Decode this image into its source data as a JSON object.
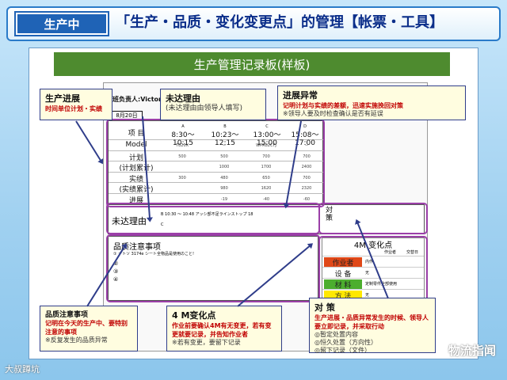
{
  "header": {
    "tag": "生产中",
    "title": "「生产・品质・变化变更点」的管理【帐票・工具】"
  },
  "board": {
    "title": "生产管理记录板(样板)",
    "manager": "班负责人:Victor",
    "date": "8月20日",
    "table": {
      "item_label": "项  目",
      "columns": [
        {
          "letter": "A",
          "time": "8:30～ 10:15"
        },
        {
          "letter": "B",
          "time": "10:23～ 12:15"
        },
        {
          "letter": "C",
          "time": "13:00～15:00"
        },
        {
          "letter": "D",
          "time": "15:08～17:00"
        }
      ],
      "rows": [
        {
          "label": "Model",
          "cells": [
            "7820X",
            "--",
            "WPR82CFJ",
            "--"
          ]
        },
        {
          "label": "计划",
          "cells": [
            "500",
            "500",
            "700",
            "700"
          ]
        },
        {
          "label": "(计划累计)",
          "cells": [
            "",
            "1000",
            "1700",
            "2400"
          ]
        },
        {
          "label": "实绩",
          "cells": [
            "300",
            "480",
            "650",
            "700"
          ]
        },
        {
          "label": "(实绩累计)",
          "cells": [
            "",
            "980",
            "1620",
            "2320"
          ]
        },
        {
          "label": "进展",
          "cells": [
            "",
            "-19",
            "-40",
            "-60"
          ]
        }
      ]
    },
    "reason_label": "未达理由",
    "reason_rows": [
      "B    10:30  ～  10:48     アッシ部不足ラインストップ         18",
      "C"
    ],
    "measure_label": "対策",
    "quality_label": "品质注意事项",
    "quality_rows": [
      "① ナトソ  3174e  シート全物品是使用のこと!",
      "②",
      "③",
      "④"
    ],
    "m4": {
      "title": "4M 变化点",
      "header_cols": [
        "",
        "作业者",
        "交替日"
      ],
      "rows": [
        {
          "label": "作业者",
          "color": "#e04818",
          "value": "内作"
        },
        {
          "label": "设  备",
          "color": "#ffffff",
          "value": "无"
        },
        {
          "label": "材  料",
          "color": "#4cae2e",
          "value": "定制零件全部使用"
        },
        {
          "label": "方  法",
          "color": "#ffe800",
          "value": "无"
        }
      ]
    }
  },
  "callouts": {
    "progress": {
      "title": "生产进展",
      "body": "时间单位计划・实绩"
    },
    "unmet": {
      "title": "未达理由",
      "body": "(未达理由由领导人填写)"
    },
    "abnormal": {
      "title": "进展异常",
      "body": "记明计划与实绩的差额，迅速实施挽回对策",
      "note": "※领导人要及时检查确认是否有延误"
    },
    "quality": {
      "title": "品质注意事项",
      "body": "记明在今天的生产中、要特别注意的事项",
      "note": "※反复发生的品质异常"
    },
    "change": {
      "title": "4 M变化点",
      "body": "作业前要确认4M有无变更，若有变更就要记录，并告知作业者",
      "note": "※若有变更，要留下记录"
    },
    "measures": {
      "title": "对  策",
      "body": "生产进展・品质异常发生的时候、领导人要立即记录，并采取行动",
      "items": [
        "◎暂定处置内容",
        "◎恒久处置（方向性）",
        "◎留下记录（文件）"
      ]
    }
  },
  "watermark": "物流指闻",
  "source": "大叔蹲坑",
  "colors": {
    "header_tag": "#1f63b6",
    "board_title": "#4e8b2f",
    "callout_border": "#2f3d8a",
    "highlight": "#9b3fa8"
  }
}
